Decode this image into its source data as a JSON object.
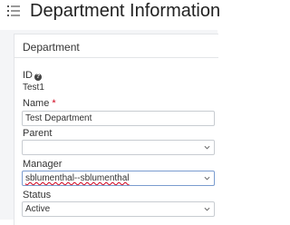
{
  "header": {
    "title": "Department Information"
  },
  "section": {
    "title": "Department"
  },
  "fields": {
    "id": {
      "label": "ID",
      "value": "Test1"
    },
    "name": {
      "label": "Name",
      "required_mark": "*",
      "value": "Test Department"
    },
    "parent": {
      "label": "Parent",
      "value": ""
    },
    "manager": {
      "label": "Manager",
      "value": "sblumenthal--sblumenthal"
    },
    "status": {
      "label": "Status",
      "value": "Active"
    }
  },
  "colors": {
    "required": "#d0021b",
    "border": "#c8ccd1",
    "focus_border": "#7a9ccf",
    "background": "#f4f5f7"
  },
  "icons": [
    "menu-list-icon",
    "help-icon",
    "chevron-down-icon"
  ]
}
